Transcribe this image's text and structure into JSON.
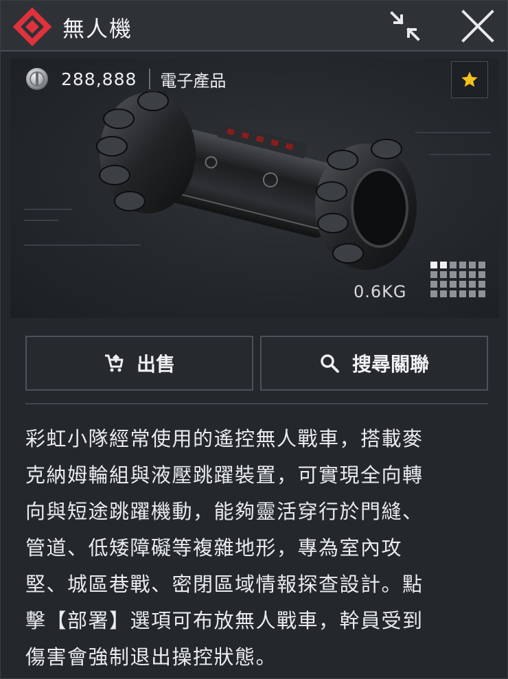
{
  "header": {
    "title": "無人機",
    "accent_color": "#e0323c"
  },
  "item": {
    "price": "288,888",
    "category": "電子產品",
    "weight": "0.6KG",
    "favorite_color": "#f3c21c"
  },
  "actions": {
    "sell_label": "出售",
    "search_label": "搜尋關聯"
  },
  "description": "彩虹小隊經常使用的遙控無人戰車，搭載麥\n克納姆輪組與液壓跳躍裝置，可實現全向轉\n向與短途跳躍機動，能夠靈活穿行於門縫、\n管道、低矮障礙等複雜地形，專為室內攻\n堅、城區巷戰、密閉區域情報探查設計。點\n擊【部署】選項可布放無人戰車，幹員受到\n傷害會強制退出操控狀態。",
  "icons": {
    "logo": "diamond-logo-icon",
    "minimize": "collapse-arrows-icon",
    "close": "close-x-icon",
    "currency": "coin-icon",
    "favorite": "star-icon",
    "size": "inventory-grid-icon",
    "sell": "cart-icon",
    "search": "search-icon"
  }
}
